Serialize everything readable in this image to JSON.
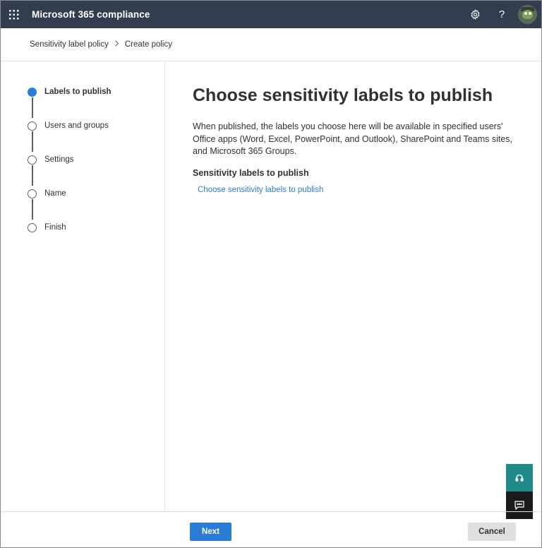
{
  "app": {
    "title": "Microsoft 365 compliance",
    "icons": [
      "waffle-icon",
      "gear-icon",
      "help-icon",
      "avatar"
    ]
  },
  "breadcrumb": {
    "items": [
      "Sensitivity label policy",
      "Create policy"
    ],
    "separator": ">"
  },
  "steps": [
    {
      "label": "Labels to publish",
      "active": true
    },
    {
      "label": "Users and groups",
      "active": false
    },
    {
      "label": "Settings",
      "active": false
    },
    {
      "label": "Name",
      "active": false
    },
    {
      "label": "Finish",
      "active": false
    }
  ],
  "main": {
    "title": "Choose sensitivity labels to publish",
    "description": "When published, the labels you choose here will be available in specified users' Office apps (Word, Excel, PowerPoint, and Outlook), SharePoint and Teams sites, and Microsoft 365 Groups.",
    "section_label": "Sensitivity labels to publish",
    "choose_link": "Choose sensitivity labels to publish"
  },
  "footer": {
    "next_label": "Next",
    "cancel_label": "Cancel"
  },
  "colors": {
    "topbar": "#323e4f",
    "accent": "#2b7cd3",
    "help_float": "#1f8a8a",
    "feedback_float": "#1b1a19"
  }
}
